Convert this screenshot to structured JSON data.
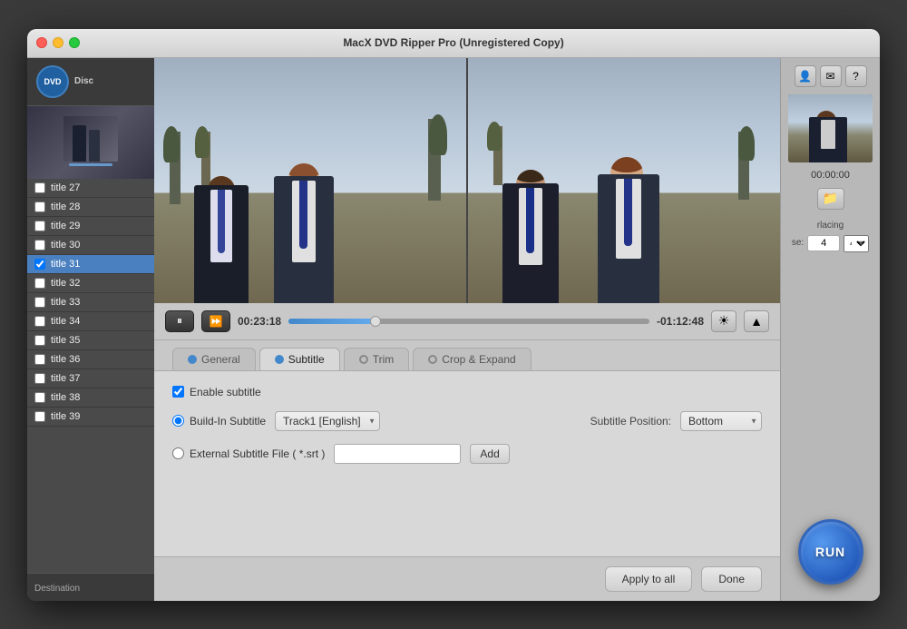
{
  "window": {
    "title": "MacX DVD Ripper Pro (Unregistered Copy)"
  },
  "sidebar": {
    "logo_text": "DVD",
    "disc_label": "Disc",
    "titles": [
      {
        "id": 27,
        "label": "title 27",
        "checked": false,
        "selected": false
      },
      {
        "id": 28,
        "label": "title 28",
        "checked": false,
        "selected": false
      },
      {
        "id": 29,
        "label": "title 29",
        "checked": false,
        "selected": false
      },
      {
        "id": 30,
        "label": "title 30",
        "checked": false,
        "selected": false
      },
      {
        "id": 31,
        "label": "title 31",
        "checked": true,
        "selected": true
      },
      {
        "id": 32,
        "label": "title 32",
        "checked": false,
        "selected": false
      },
      {
        "id": 33,
        "label": "title 33",
        "checked": false,
        "selected": false
      },
      {
        "id": 34,
        "label": "title 34",
        "checked": false,
        "selected": false
      },
      {
        "id": 35,
        "label": "title 35",
        "checked": false,
        "selected": false
      },
      {
        "id": 36,
        "label": "title 36",
        "checked": false,
        "selected": false
      },
      {
        "id": 37,
        "label": "title 37",
        "checked": false,
        "selected": false
      },
      {
        "id": 38,
        "label": "title 38",
        "checked": false,
        "selected": false
      },
      {
        "id": 39,
        "label": "title 39",
        "checked": false,
        "selected": false
      }
    ],
    "destination_label": "Destination"
  },
  "player": {
    "time_current": "00:23:18",
    "time_remaining": "-01:12:48",
    "progress_percent": 24,
    "timecode": "00:00:00"
  },
  "tabs": [
    {
      "label": "General",
      "active": false
    },
    {
      "label": "Subtitle",
      "active": true
    },
    {
      "label": "Trim",
      "active": false
    },
    {
      "label": "Crop & Expand",
      "active": false
    }
  ],
  "subtitle": {
    "enable_label": "Enable subtitle",
    "builtin_label": "Build-In Subtitle",
    "builtin_track": "Track1 [English]",
    "external_label": "External Subtitle File ( *.srt )",
    "add_btn": "Add",
    "position_label": "Subtitle Position:",
    "position_value": "Bottom"
  },
  "buttons": {
    "apply_to_all": "Apply to all",
    "done": "Done",
    "run": "RUN"
  },
  "right_panel": {
    "deinterlace_label": "rlacing",
    "deinterlace_prefix": "se:",
    "deinterlace_value": "4"
  }
}
